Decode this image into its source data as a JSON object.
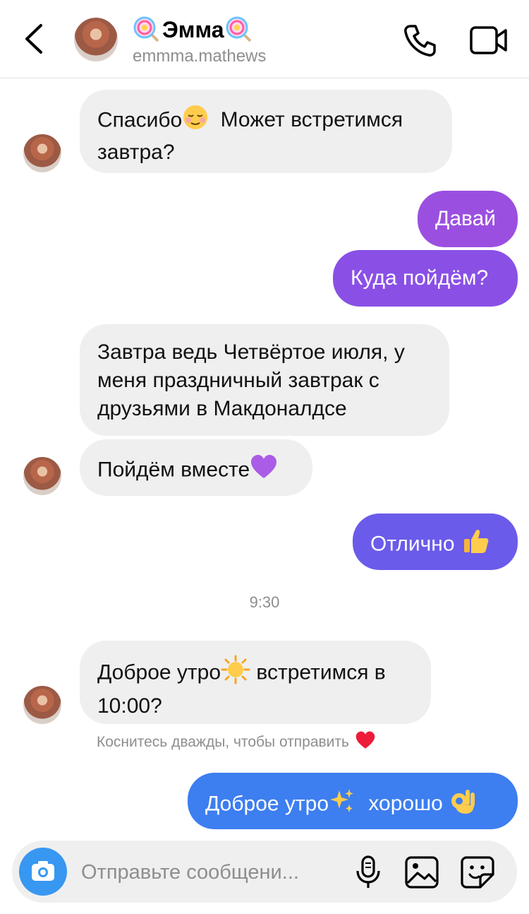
{
  "header": {
    "name": "Эмма",
    "username": "emmma.mathews",
    "left_emoji": "lollipop-icon",
    "right_emoji": "lollipop-icon"
  },
  "messages": [
    {
      "side": "in",
      "lines": [
        "Спасибо",
        "Может встретимся",
        "завтра?"
      ]
    },
    {
      "side": "out",
      "text": "Давай"
    },
    {
      "side": "out",
      "text": "Куда пойдём?"
    },
    {
      "side": "in",
      "lines": [
        "Завтра ведь Четвёртое июля, у",
        "меня праздничный завтрак с",
        "друзьями в Макдоналдсе"
      ]
    },
    {
      "side": "in",
      "text": "Пойдём вместе"
    },
    {
      "side": "out",
      "text": "Отлично"
    },
    {
      "side": "in",
      "lines": [
        "Доброе утро",
        "встретимся в",
        "10:00?"
      ]
    },
    {
      "side": "out",
      "lines": [
        "Доброе утро",
        "хорошо"
      ]
    }
  ],
  "timestamp": "9:30",
  "hint": "Коснитесь дважды, чтобы отправить",
  "composer": {
    "placeholder": "Отправьте сообщени..."
  },
  "colors": {
    "purple": "#9b4fe0",
    "violet": "#7d52ea",
    "indigo": "#6a5bea",
    "blue": "#3d7ef0"
  }
}
